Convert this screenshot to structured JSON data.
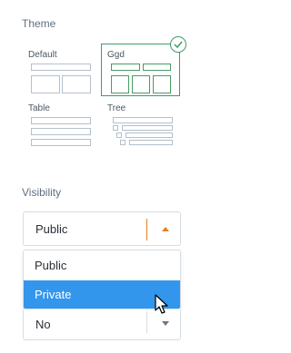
{
  "theme": {
    "label": "Theme",
    "options": [
      {
        "name": "Default",
        "selected": false
      },
      {
        "name": "Ggd",
        "selected": true
      },
      {
        "name": "Table",
        "selected": false
      },
      {
        "name": "Tree",
        "selected": false
      }
    ],
    "selected_icon": "check-icon"
  },
  "visibility": {
    "label": "Visibility",
    "current_value": "Public",
    "options": [
      "Public",
      "Private"
    ],
    "highlighted_option": "Private"
  },
  "second_select": {
    "current_value": "No"
  },
  "colors": {
    "accent_orange": "#e67e22",
    "selected_green": "#3e9c6a",
    "highlight_blue": "#3296ec"
  }
}
